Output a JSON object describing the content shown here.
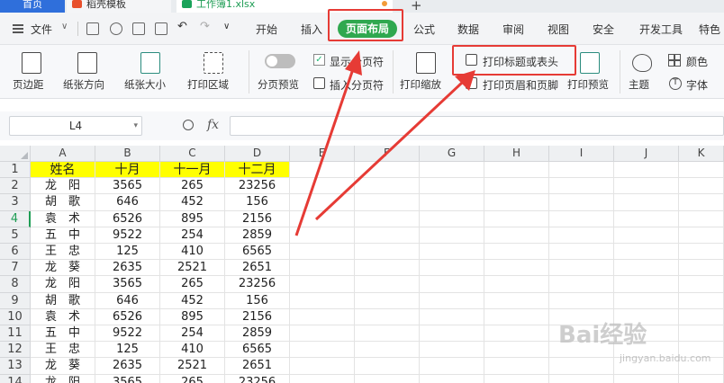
{
  "tabs": {
    "home": "首页",
    "template": "稻壳模板",
    "file": "工作簿1.xlsx"
  },
  "menu": {
    "file": "文件",
    "tabs": [
      "开始",
      "插入",
      "页面布局",
      "公式",
      "数据",
      "审阅",
      "视图",
      "安全",
      "开发工具",
      "特色"
    ]
  },
  "ribbon": {
    "margins": "页边距",
    "orientation": "纸张方向",
    "size": "纸张大小",
    "print_area": "打印区域",
    "page_break_preview": "分页预览",
    "show_page_break": "显示分页符",
    "insert_page_break": "插入分页符",
    "print_scale": "打印缩放",
    "print_titles": "打印标题或表头",
    "print_header_footer": "打印页眉和页脚",
    "print_preview": "打印预览",
    "theme": "主题",
    "colors": "颜色",
    "fonts": "字体"
  },
  "formula_bar": {
    "name_box": "L4",
    "fx": "fx"
  },
  "sheet": {
    "columns": [
      "A",
      "B",
      "C",
      "D",
      "E",
      "F",
      "G",
      "H",
      "I",
      "J",
      "K"
    ],
    "rows": [
      "1",
      "2",
      "3",
      "4",
      "5",
      "6",
      "7",
      "8",
      "9",
      "10",
      "11",
      "12",
      "13",
      "14"
    ],
    "selected_row": "4",
    "header": [
      "姓名",
      "十月",
      "十一月",
      "十二月"
    ],
    "data": [
      [
        "龙　阳",
        "3565",
        "265",
        "23256"
      ],
      [
        "胡　歌",
        "646",
        "452",
        "156"
      ],
      [
        "袁　术",
        "6526",
        "895",
        "2156"
      ],
      [
        "五　中",
        "9522",
        "254",
        "2859"
      ],
      [
        "王　忠",
        "125",
        "410",
        "6565"
      ],
      [
        "龙　葵",
        "2635",
        "2521",
        "2651"
      ],
      [
        "龙　阳",
        "3565",
        "265",
        "23256"
      ],
      [
        "胡　歌",
        "646",
        "452",
        "156"
      ],
      [
        "袁　术",
        "6526",
        "895",
        "2156"
      ],
      [
        "五　中",
        "9522",
        "254",
        "2859"
      ],
      [
        "王　忠",
        "125",
        "410",
        "6565"
      ],
      [
        "龙　葵",
        "2635",
        "2521",
        "2651"
      ],
      [
        "龙　阳",
        "3565",
        "265",
        "23256"
      ]
    ]
  },
  "watermark": {
    "brand": "Bai经验",
    "url": "jingyan.baidu.com"
  },
  "colors": {
    "accent_green": "#2fa84f",
    "annotation_red": "#e63b35",
    "header_fill": "#ffff00"
  }
}
